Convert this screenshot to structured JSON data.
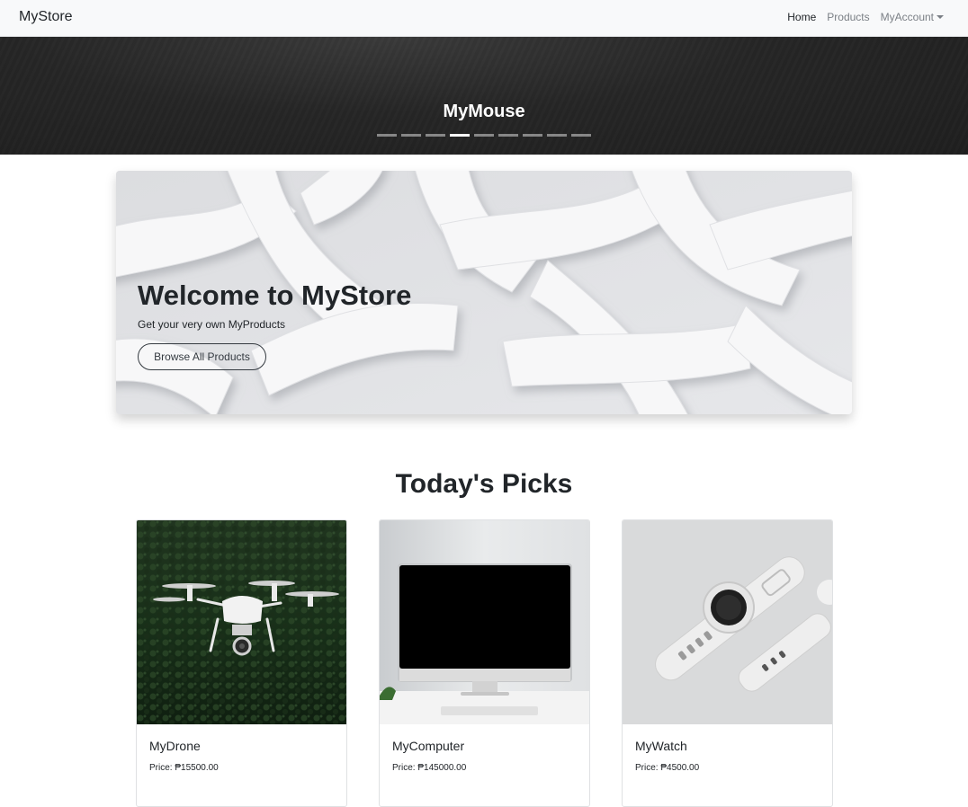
{
  "navbar": {
    "brand": "MyStore",
    "links": [
      {
        "label": "Home",
        "active": true
      },
      {
        "label": "Products",
        "active": false
      },
      {
        "label": "MyAccount",
        "active": false
      }
    ]
  },
  "carousel": {
    "caption": "MyMouse",
    "slide_count": 9,
    "active_index": 3
  },
  "hero": {
    "title": "Welcome to MyStore",
    "subtitle": "Get your very own MyProducts",
    "button_label": "Browse All Products"
  },
  "picks": {
    "title": "Today's Picks",
    "items": [
      {
        "name": "MyDrone",
        "price": "Price: ₱15500.00",
        "image": "drone-photo"
      },
      {
        "name": "MyComputer",
        "price": "Price: ₱145000.00",
        "image": "computer-photo"
      },
      {
        "name": "MyWatch",
        "price": "Price: ₱4500.00",
        "image": "watch-photo"
      }
    ]
  },
  "colors": {
    "navbar_bg": "#f8f9fa",
    "carousel_bg": "#262626",
    "text": "#212529",
    "muted": "#7a7f85"
  }
}
